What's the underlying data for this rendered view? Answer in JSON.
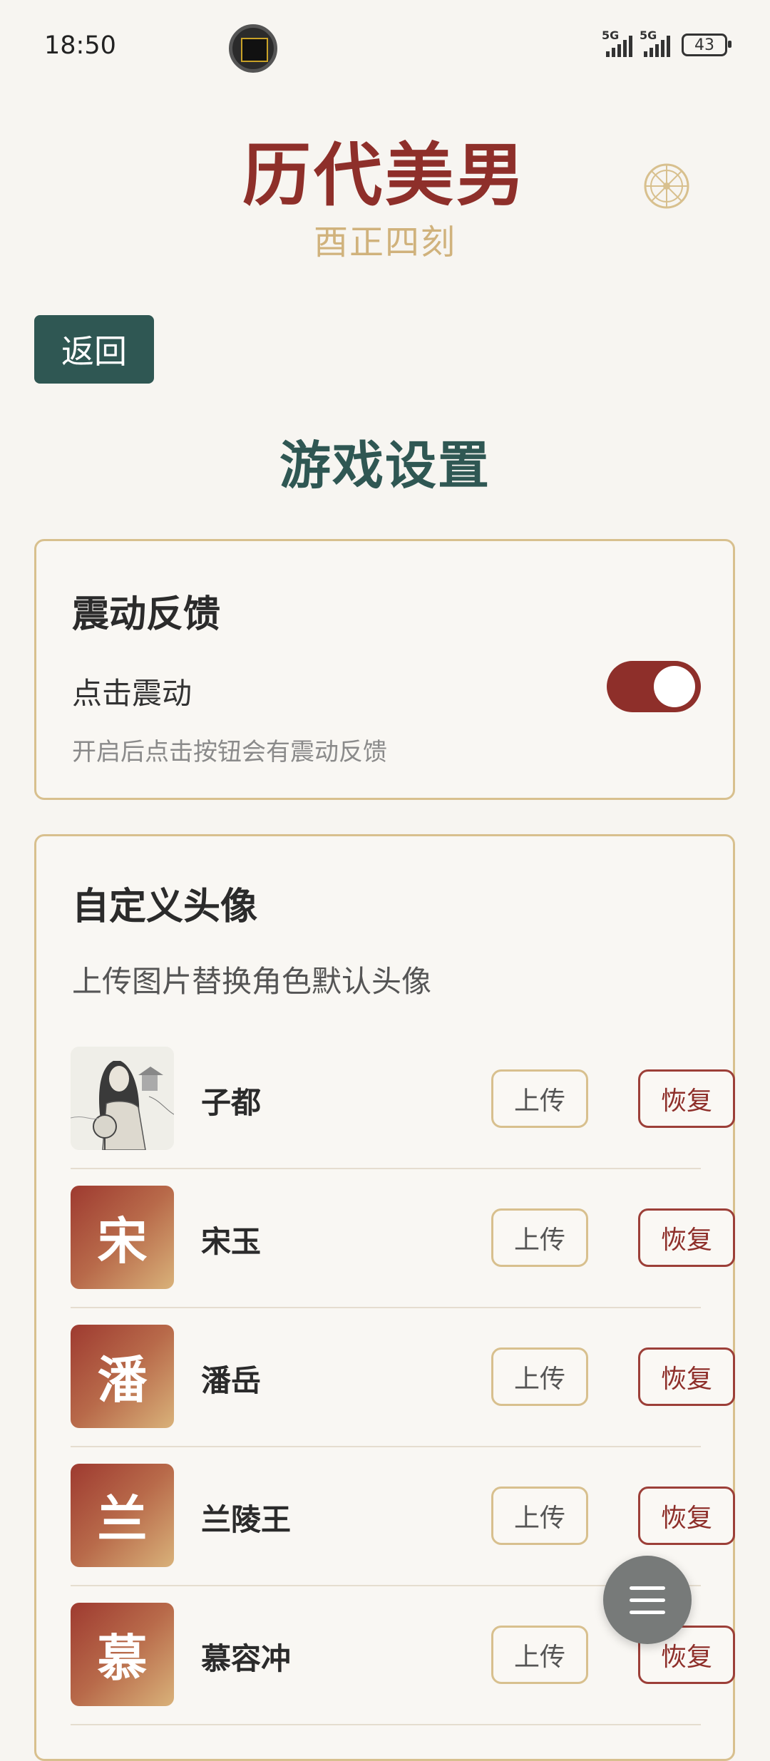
{
  "status_bar": {
    "time": "18:50",
    "network_1": "5G",
    "network_2": "5G",
    "battery": "43"
  },
  "header": {
    "title": "历代美男",
    "subtitle": "酉正四刻"
  },
  "back_label": "返回",
  "page_title": "游戏设置",
  "vibration": {
    "title": "震动反馈",
    "label": "点击震动",
    "hint": "开启后点击按钮会有震动反馈",
    "enabled": true
  },
  "avatars": {
    "title": "自定义头像",
    "description": "上传图片替换角色默认头像",
    "upload_label": "上传",
    "restore_label": "恢复",
    "items": [
      {
        "name": "子都",
        "initial": ""
      },
      {
        "name": "宋玉",
        "initial": "宋"
      },
      {
        "name": "潘岳",
        "initial": "潘"
      },
      {
        "name": "兰陵王",
        "initial": "兰"
      },
      {
        "name": "慕容冲",
        "initial": "慕"
      }
    ]
  },
  "colors": {
    "primary_red": "#8e2f2a",
    "teal": "#2f5753",
    "gold": "#d8c08e"
  }
}
